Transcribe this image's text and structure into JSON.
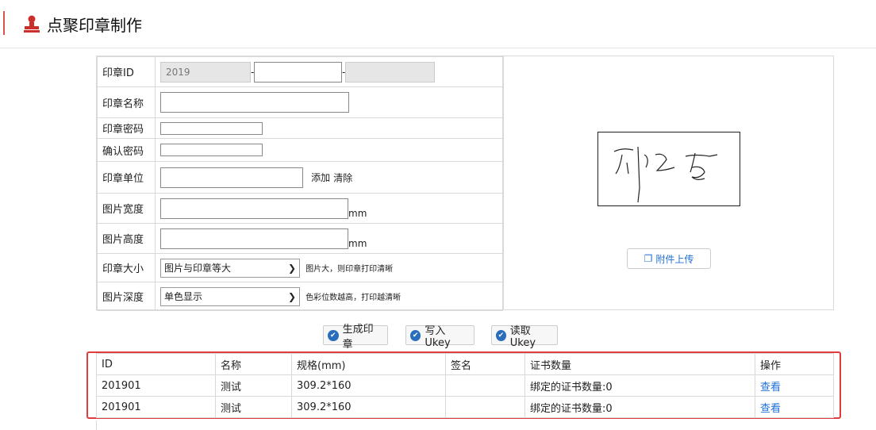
{
  "header": {
    "title": "点聚印章制作",
    "icon": "red-stamp-icon"
  },
  "form": {
    "seal_id": {
      "label": "印章ID",
      "part1": "2019",
      "part2": "",
      "part3": ""
    },
    "seal_name": {
      "label": "印章名称",
      "value": ""
    },
    "seal_password": {
      "label": "印章密码",
      "value": ""
    },
    "confirm_password": {
      "label": "确认密码",
      "value": ""
    },
    "seal_unit": {
      "label": "印章单位",
      "value": "",
      "add_label": "添加",
      "clear_label": "清除"
    },
    "image_width": {
      "label": "图片宽度",
      "value": "",
      "unit": "mm"
    },
    "image_height": {
      "label": "图片高度",
      "value": "",
      "unit": "mm"
    },
    "seal_size": {
      "label": "印章大小",
      "selected": "图片与印章等大",
      "hint": "图片大，则印章打印清晰"
    },
    "image_depth": {
      "label": "图片深度",
      "selected": "单色显示",
      "hint": "色彩位数越高，打印越清晰"
    }
  },
  "upload": {
    "label": "附件上传"
  },
  "actions": {
    "generate": "生成印章",
    "write": "写入Ukey",
    "read": "读取Ukey"
  },
  "grid": {
    "headers": [
      "ID",
      "名称",
      "规格(mm)",
      "签名",
      "证书数量",
      "操作"
    ],
    "rows": [
      {
        "id": "201901",
        "name": "测试",
        "spec": "309.2*160",
        "sign": "",
        "cert": "绑定的证书数量:0",
        "op": "查看"
      },
      {
        "id": "201901",
        "name": "测试",
        "spec": "309.2*160",
        "sign": "",
        "cert": "绑定的证书数量:0",
        "op": "查看"
      }
    ]
  },
  "colors": {
    "accent": "#d9534f",
    "link": "#1e6fd8",
    "highlight": "#e03c3c"
  }
}
